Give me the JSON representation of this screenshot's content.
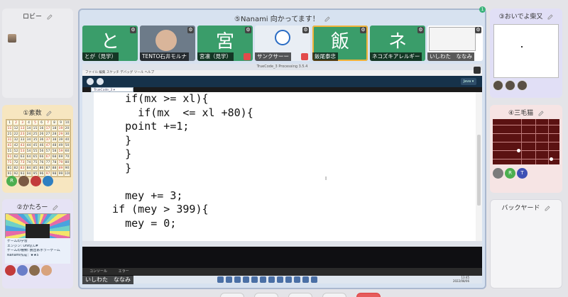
{
  "lobby": {
    "title": "ロビー"
  },
  "sosu": {
    "title": "①素数",
    "grid": [
      [
        "1",
        "2",
        "3",
        "4",
        "5",
        "6",
        "7",
        "8",
        "9",
        "10"
      ],
      [
        "11",
        "12",
        "13",
        "14",
        "15",
        "16",
        "17",
        "18",
        "19",
        "20"
      ],
      [
        "21",
        "22",
        "23",
        "24",
        "25",
        "26",
        "27",
        "28",
        "29",
        "30"
      ],
      [
        "31",
        "32",
        "33",
        "34",
        "35",
        "36",
        "37",
        "38",
        "39",
        "40"
      ],
      [
        "41",
        "42",
        "43",
        "44",
        "45",
        "46",
        "47",
        "48",
        "49",
        "50"
      ],
      [
        "51",
        "52",
        "53",
        "54",
        "55",
        "56",
        "57",
        "58",
        "59",
        "60"
      ],
      [
        "61",
        "62",
        "63",
        "64",
        "65",
        "66",
        "67",
        "68",
        "69",
        "70"
      ],
      [
        "71",
        "72",
        "73",
        "74",
        "75",
        "76",
        "77",
        "78",
        "79",
        "80"
      ],
      [
        "81",
        "82",
        "83",
        "84",
        "85",
        "86",
        "87",
        "88",
        "89",
        "90"
      ],
      [
        "91",
        "92",
        "93",
        "94",
        "95",
        "96",
        "97",
        "98",
        "99",
        "100"
      ]
    ],
    "avatar_letter": "R"
  },
  "katarou": {
    "title": "②かたろー",
    "slide_lines": [
      "ゲームの学習",
      "エンジン: Unity,C#",
      "ゲームの種類: 脱出系ホラーゲーム",
      "Nanami作成：★★5"
    ]
  },
  "main": {
    "title": "⑤Nanami 向かってます！",
    "badge": "1",
    "tiles": [
      {
        "letter": "と",
        "name": "とが（見学）",
        "color": "#3a9d6a"
      },
      {
        "letter": "",
        "name": "TENTO石井モルナ",
        "color": "#6d7b89"
      },
      {
        "letter": "宮",
        "name": "宮凛（見学）",
        "color": "#3a9d6a"
      },
      {
        "letter": "",
        "name": "サンクサーー",
        "color": "#e9eef4"
      },
      {
        "letter": "飯",
        "name": "飯尾泰忠",
        "color": "#3a9d6a"
      },
      {
        "letter": "ネ",
        "name": "ネコズキアレルギー",
        "color": "#3a9d6a"
      },
      {
        "letter": "",
        "name": "いしわた　ななみ",
        "color": "#ffffff"
      }
    ],
    "share": {
      "window_title": "TrueCode_3 Processing 3.5.4",
      "menu": "ファイル 編集 スケッチ デバッグ ツール ヘルプ",
      "tab_label": "TrueCode_3 ▾",
      "mode_label": "Java ▾",
      "code_lines": [
        "    if(mx >= xl){",
        "      if(mx  <= xl +80){",
        "    point +=1;",
        "    }",
        "    }",
        "    }",
        "",
        "    mey += 3;",
        "  if (mey > 399){",
        "    mey = 0;"
      ],
      "console_tabs": [
        "コンソール",
        "エラー"
      ],
      "clock": "13:45\n2022/08/06",
      "presenter": "いしわた　ななみ"
    }
  },
  "oideyo": {
    "title": "③おいでよ柴又"
  },
  "mikesen": {
    "title": "④三毛猫"
  },
  "backyard": {
    "title": "バックヤード"
  },
  "colors": {
    "main_border": "#aab8cf",
    "accent": "#f1b33a",
    "edit_icon": "#888888"
  }
}
